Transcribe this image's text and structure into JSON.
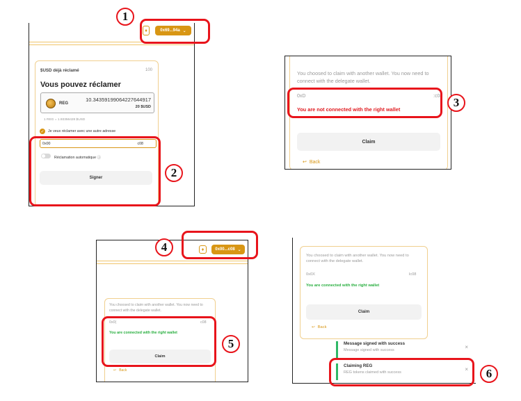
{
  "markers": [
    "1",
    "2",
    "3",
    "4",
    "5",
    "6"
  ],
  "panel1": {
    "wallet_label": "0x69...94a",
    "claimed_label": "$USD déjà réclamé",
    "claimed_value": "100",
    "heading": "Vous pouvez réclamer",
    "token_symbol": "REG",
    "token_amount": "10.34359199064227644917",
    "token_usd": "20 $USD",
    "rate": "1 REG = 1.93356428 $USD",
    "checkbox_label": "Je veux réclamer avec une autre adresse",
    "address_start": "0x00",
    "address_end": "c08",
    "auto_label": "Réclamation automatique",
    "sign_label": "Signer"
  },
  "panel2": {
    "message": "You choosed to claim with another wallet. You now need to connect with the delegate wallet.",
    "address_start": "0xD",
    "address_end": ":c08",
    "status": "You are not connected with the right wallet",
    "claim_label": "Claim",
    "back_label": "Back"
  },
  "panel3": {
    "wallet_label": "0x00...c08",
    "message": "You choosed to claim with another wallet. You now need to connect with the delegate wallet.",
    "address_start": "0x0(",
    "address_end": "c08",
    "status": "You are connected with the right wallet",
    "claim_label": "Claim",
    "back_label": "Back"
  },
  "panel4": {
    "message": "You choosed to claim with another wallet. You now need to connect with the delegate wallet.",
    "address_start": "0x0X",
    "address_end": "lc08",
    "status": "You are connected with the right wallet",
    "claim_label": "Claim",
    "back_label": "Back",
    "toasts": [
      {
        "title": "Message signed with success",
        "body": "Message signed with success"
      },
      {
        "title": "Claiming REG",
        "body": "REG tokens claimed with success"
      }
    ]
  },
  "colors": {
    "accent": "#d89614",
    "annotation": "#e8141b",
    "success": "#27ae3e",
    "error": "#e0191e"
  }
}
